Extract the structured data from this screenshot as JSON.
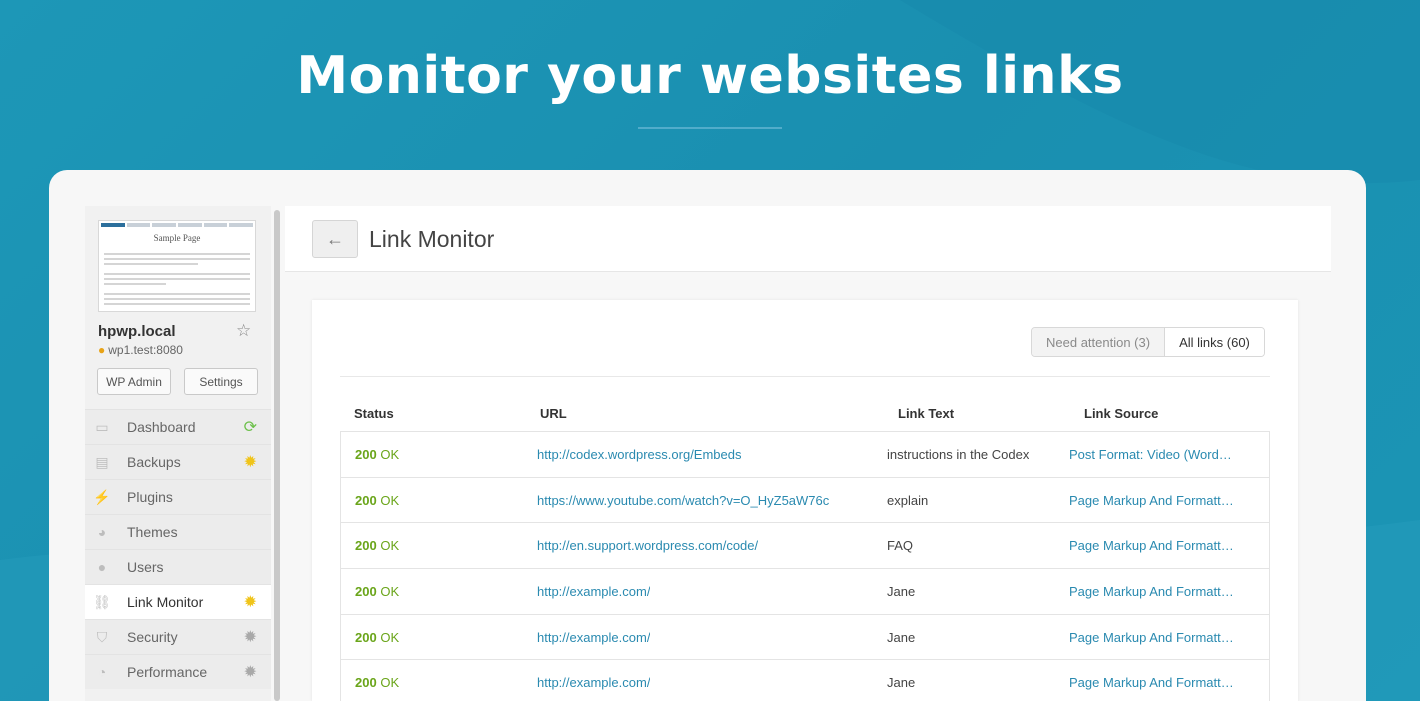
{
  "headline": "Monitor your websites links",
  "sidebar": {
    "thumbnail_title": "Sample Page",
    "site_name": "hpwp.local",
    "site_url": "wp1.test:8080",
    "wp_admin_label": "WP Admin",
    "settings_label": "Settings",
    "menu": [
      {
        "label": "Dashboard",
        "icon": "monitor-icon",
        "badge": "refresh-icon"
      },
      {
        "label": "Backups",
        "icon": "hdd-icon",
        "badge": "gear-warning-icon"
      },
      {
        "label": "Plugins",
        "icon": "plug-icon",
        "badge": ""
      },
      {
        "label": "Themes",
        "icon": "palette-icon",
        "badge": ""
      },
      {
        "label": "Users",
        "icon": "user-icon",
        "badge": ""
      },
      {
        "label": "Link Monitor",
        "icon": "link-icon",
        "badge": "gear-warning-icon",
        "active": true
      },
      {
        "label": "Security",
        "icon": "shield-icon",
        "badge": "gear-icon"
      },
      {
        "label": "Performance",
        "icon": "gauge-icon",
        "badge": "gear-icon"
      }
    ]
  },
  "main": {
    "title": "Link Monitor",
    "filters": {
      "need_attention": "Need attention (3)",
      "all_links": "All links (60)"
    },
    "columns": [
      "Status",
      "URL",
      "Link Text",
      "Link Source"
    ],
    "rows": [
      {
        "code": "200",
        "status": "OK",
        "url": "http://codex.wordpress.org/Embeds",
        "text": "instructions in the Codex",
        "source": "Post Format: Video (Word…"
      },
      {
        "code": "200",
        "status": "OK",
        "url": "https://www.youtube.com/watch?v=O_HyZ5aW76c",
        "text": "explain",
        "source": "Page Markup And Formatt…"
      },
      {
        "code": "200",
        "status": "OK",
        "url": "http://en.support.wordpress.com/code/",
        "text": "FAQ",
        "source": "Page Markup And Formatt…"
      },
      {
        "code": "200",
        "status": "OK",
        "url": "http://example.com/",
        "text": "Jane",
        "source": "Page Markup And Formatt…"
      },
      {
        "code": "200",
        "status": "OK",
        "url": "http://example.com/",
        "text": "Jane",
        "source": "Page Markup And Formatt…"
      },
      {
        "code": "200",
        "status": "OK",
        "url": "http://example.com/",
        "text": "Jane",
        "source": "Page Markup And Formatt…"
      }
    ]
  },
  "colors": {
    "status_ok": "#6aa51a",
    "link": "#2a8ab0",
    "background": "#1a8fb0",
    "warning": "#f0c419",
    "refresh": "#6cc04a"
  }
}
